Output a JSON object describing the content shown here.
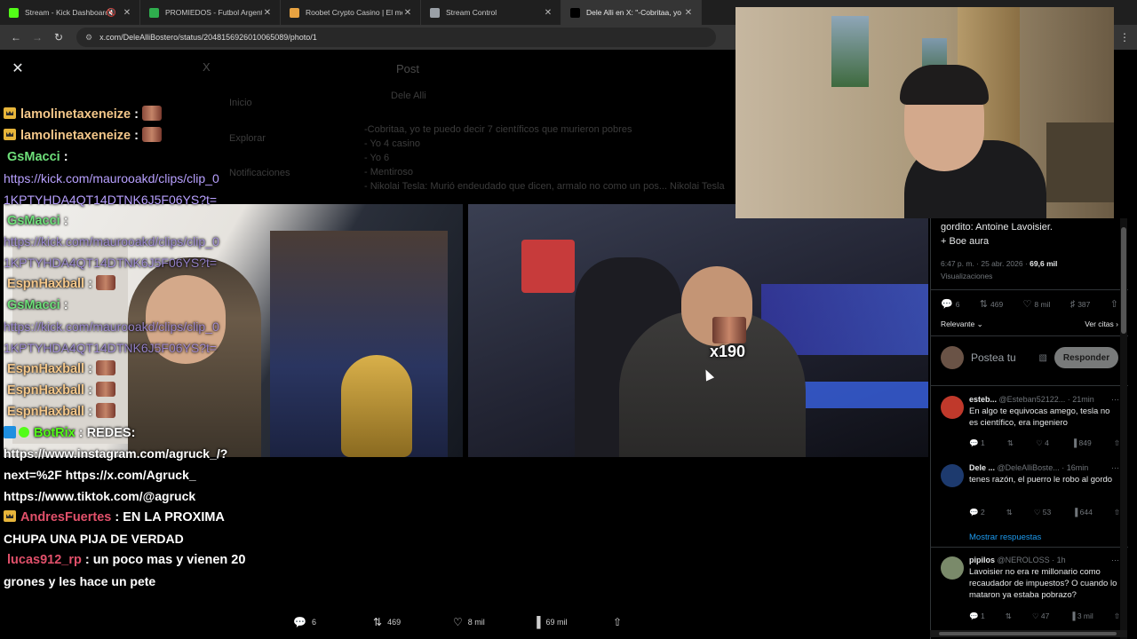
{
  "browser": {
    "tabs": [
      {
        "label": "Stream - Kick Dashboard",
        "favicon_color": "#53fc18",
        "muted": true,
        "active": false
      },
      {
        "label": "PROMIEDOS - Futbol Argentino",
        "favicon_color": "#2fae4e",
        "muted": false,
        "active": false
      },
      {
        "label": "Roobet Crypto Casino | El mejo",
        "favicon_color": "#e8a341",
        "muted": false,
        "active": false
      },
      {
        "label": "Stream Control",
        "favicon_color": "#9aa0a6",
        "muted": false,
        "active": false
      },
      {
        "label": "Dele Alli en X: \"-Cobritaa, yo te",
        "favicon_color": "#000000",
        "muted": false,
        "active": true
      }
    ],
    "url": "x.com/DeleAlliBostero/status/2048156926010065089/photo/1"
  },
  "tweet": {
    "text_line1": "gordito: Antoine Lavoisier.",
    "text_line2": "+ Boe aura",
    "time": "6:47 p. m. · 25 abr. 2026 · ",
    "views_value": "69,6 mil",
    "views_label": "Visualizaciones",
    "stats": {
      "replies": "6",
      "reposts": "469",
      "likes": "8 mil",
      "bookmarks": "387"
    },
    "sort_label": "Relevante",
    "quotes_label": "Ver citas",
    "reply_placeholder": "Postea tu",
    "reply_button": "Responder"
  },
  "replies": [
    {
      "name": "esteb...",
      "handle": "@Esteban52122...",
      "time": "21min",
      "body": "En algo te equivocas amego, tesla no es científico, era ingeniero",
      "replies": "1",
      "reposts": "",
      "likes": "4",
      "views": "849",
      "avatar_color": "#c0392b"
    },
    {
      "name": "Dele ...",
      "handle": "@DeleAlliBoste...",
      "time": "16min",
      "body": "tenes razón, el puerro le robo al gordo",
      "replies": "2",
      "reposts": "",
      "likes": "53",
      "views": "644",
      "avatar_color": "#1d3a6e"
    },
    {
      "name": "pipilos",
      "handle": "@NEROLOSS",
      "time": "1h",
      "body": "Lavoisier no era re millonario como recaudador de impuestos? O cuando lo mataron ya estaba pobrazo?",
      "replies": "1",
      "reposts": "",
      "likes": "47",
      "views": "3 mil",
      "avatar_color": "#7a8a6a"
    }
  ],
  "show_replies": "Mostrar respuestas",
  "bottom_actions": {
    "replies": "6",
    "reposts": "469",
    "likes": "8 mil",
    "views": "69 mil"
  },
  "chat": [
    {
      "user": "lamolinetaxeneize",
      "sep": " :",
      "user_color": "#f4c78a",
      "badge": "crown",
      "emote": true
    },
    {
      "user": "lamolinetaxeneize",
      "sep": " :",
      "user_color": "#f4c78a",
      "badge": "crown",
      "emote": true
    },
    {
      "user": "GsMacci",
      "sep": " :",
      "user_color": "#6ee07a",
      "badge": "",
      "emote": false
    },
    {
      "link": "https://kick.com/maurooakd/clips/clip_0"
    },
    {
      "link": "1KPTYHDA4QT14DTNK6J5F06YS?t="
    },
    {
      "user": "GsMacci",
      "sep": " :",
      "user_color": "#6ee07a",
      "badge": "",
      "emote": false
    },
    {
      "link": "https://kick.com/maurooakd/clips/clip_0"
    },
    {
      "link": "1KPTYHDA4QT14DTNK6J5F06YS?t="
    },
    {
      "user": "EspnHaxball",
      "sep": " :",
      "user_color": "#f4c78a",
      "badge": "",
      "emote": true
    },
    {
      "user": "GsMacci",
      "sep": " :",
      "user_color": "#6ee07a",
      "badge": "",
      "emote": false
    },
    {
      "link": "https://kick.com/maurooakd/clips/clip_0"
    },
    {
      "link": "1KPTYHDA4QT14DTNK6J5F06YS?t="
    },
    {
      "user": "EspnHaxball",
      "sep": " :",
      "user_color": "#f4c78a",
      "badge": "",
      "emote": true
    },
    {
      "user": "EspnHaxball",
      "sep": " :",
      "user_color": "#f4c78a",
      "badge": "",
      "emote": true
    },
    {
      "user": "EspnHaxball",
      "sep": " :",
      "user_color": "#f4c78a",
      "badge": "",
      "emote": true
    },
    {
      "user": "BotRix",
      "sep": " : REDES:",
      "user_color": "#53fc18",
      "badge": "bot",
      "emote": false
    },
    {
      "plain": "https://www.instagram.com/agruck_/?"
    },
    {
      "plain": "next=%2F https://x.com/Agruck_"
    },
    {
      "plain": "https://www.tiktok.com/@agruck"
    },
    {
      "user": "AndresFuertes",
      "sep": " : EN LA PROXIMA",
      "user_color": "#e0506a",
      "badge": "crown",
      "emote": false
    },
    {
      "plain": "CHUPA UNA PIJA DE VERDAD"
    },
    {
      "user": "lucas912_rp",
      "sep": " : un poco mas y vienen 20",
      "user_color": "#e0506a",
      "badge": "",
      "emote": false
    },
    {
      "plain": "grones y les hace un pete"
    }
  ],
  "overlay_counter": "x190",
  "ghost_page": {
    "header": "Post",
    "author": "Dele Alli",
    "sidebar": [
      "Inicio",
      "Explorar",
      "Notificaciones"
    ],
    "line1": "-Cobritaa, yo te puedo decir 7 científicos que murieron pobres",
    "line2": "- Yo 4 casino",
    "line3": "- Yo 6",
    "line4": "- Mentiroso",
    "line5": "- Nikolai Tesla: Murió endeudado que dicen, armalo no como un pos... Nikolai Tesla"
  }
}
